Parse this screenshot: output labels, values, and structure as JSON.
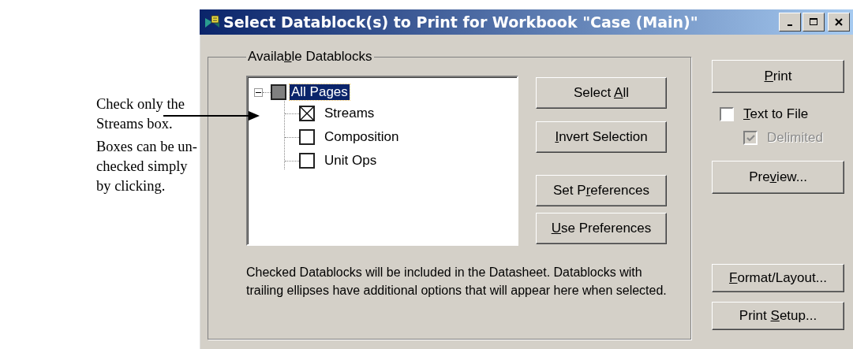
{
  "annotation": {
    "lines": [
      "Check only the Streams box.",
      "Boxes can be un-checked simply by clicking."
    ]
  },
  "window": {
    "title": "Select Datablock(s) to Print for Workbook \"Case (Main)\""
  },
  "group": {
    "label": {
      "before": "Availa",
      "key": "b",
      "after": "le Datablocks"
    }
  },
  "tree": {
    "root": {
      "label": "All Pages",
      "expanded": true,
      "selected": true,
      "checked": false,
      "indeterminate": true,
      "children": [
        {
          "label": "Streams",
          "checked": true,
          "selected": false
        },
        {
          "label": "Composition",
          "checked": false,
          "selected": false
        },
        {
          "label": "Unit Ops",
          "checked": false,
          "selected": false
        }
      ]
    }
  },
  "middle_buttons": [
    {
      "label": {
        "before": "Select ",
        "key": "A",
        "after": "ll"
      }
    },
    {
      "label": {
        "key": "I",
        "after": "nvert Selection"
      }
    },
    {
      "label": {
        "before": "Set P",
        "key": "r",
        "after": "eferences"
      }
    },
    {
      "label": {
        "key": "U",
        "after": "se Preferences"
      }
    }
  ],
  "info_text": "Checked Datablocks will be included in the Datasheet. Datablocks with trailing ellipses have additional options that will appear here when selected.",
  "print_button": {
    "label": {
      "key": "P",
      "after": "rint"
    }
  },
  "options": [
    {
      "label": {
        "key": "T",
        "after": "ext to File"
      },
      "checked": false,
      "disabled": false
    },
    {
      "label": {
        "before": "Delimited"
      },
      "checked": true,
      "disabled": true
    }
  ],
  "preview_button": {
    "label": {
      "before": "Pre",
      "key": "v",
      "after": "iew..."
    }
  },
  "bottom_buttons": [
    {
      "label": {
        "key": "F",
        "after": "ormat/Layout..."
      }
    },
    {
      "label": {
        "before": "Print ",
        "key": "S",
        "after": "etup..."
      }
    }
  ]
}
